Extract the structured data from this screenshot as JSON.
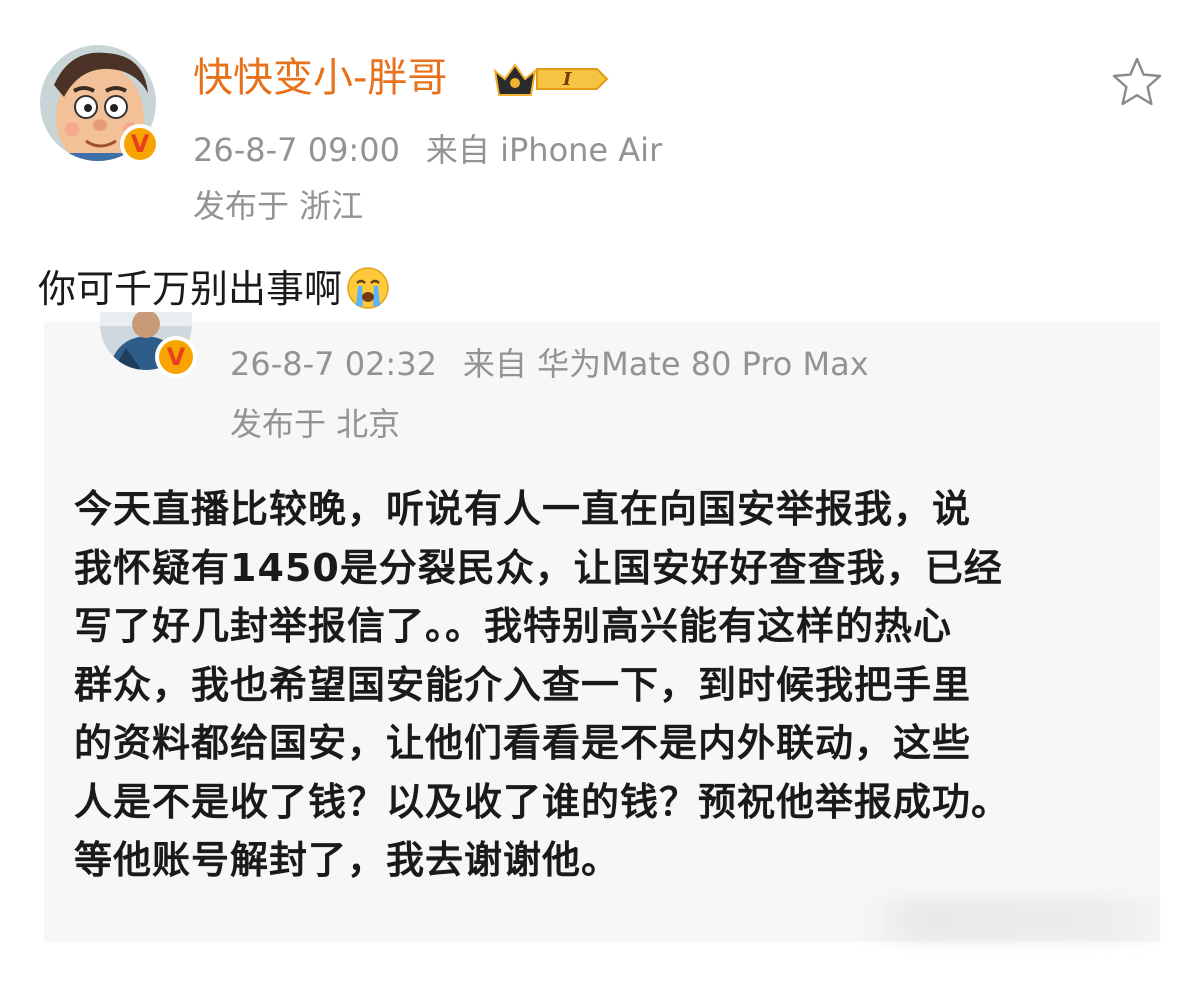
{
  "post": {
    "author": {
      "name": "快快变小-胖哥",
      "avatar_icon": "cartoon-face-avatar",
      "verified_icon": "verified-v-icon",
      "badge_icon": "crown-member-badge-icon",
      "badge_text": "I"
    },
    "time": "26-8-7 09:00",
    "source": "来自 iPhone Air",
    "location": "发布于 浙江",
    "comment": "你可千万别出事啊",
    "comment_emoji": "crying-face-emoji",
    "favorite_icon": "star-outline-icon"
  },
  "repost": {
    "avatar_icon": "person-photo-avatar",
    "verified_icon": "verified-v-icon",
    "time": "26-8-7 02:32",
    "source": "来自 华为Mate 80 Pro Max",
    "location": "发布于 北京",
    "lines": [
      "今天直播比较晚，听说有人一直在向国安举报我，说",
      "我怀疑有1450是分裂民众，让国安好好查查我，已经",
      "写了好几封举报信了。。我特别高兴能有这样的热心",
      "群众，我也希望国安能介入查一下，到时候我把手里",
      "的资料都给国安，让他们看看是不是内外联动，这些",
      "人是不是收了钱？以及收了谁的钱？预祝他举报成功。",
      "等他账号解封了，我去谢谢他。"
    ]
  },
  "colors": {
    "username": "#e8721c",
    "meta": "#939393",
    "text": "#1a1a1a",
    "card_bg": "#f7f7f7",
    "verified_bg": "#f7a400",
    "verified_v": "#e8401c"
  }
}
